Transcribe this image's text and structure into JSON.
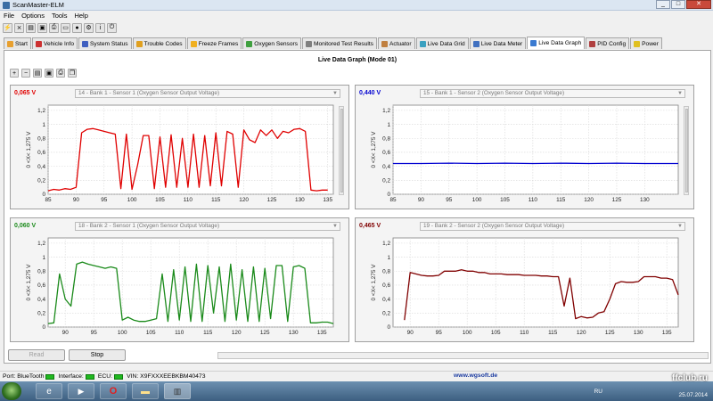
{
  "window": {
    "title": "ScanMaster-ELM",
    "min": "_",
    "max": "□",
    "close": "✕"
  },
  "menu": [
    "File",
    "Options",
    "Tools",
    "Help"
  ],
  "tabs": [
    {
      "label": "Start",
      "color": "#e8a030"
    },
    {
      "label": "Vehicle Info",
      "color": "#cc3030"
    },
    {
      "label": "System Status",
      "color": "#4060c0"
    },
    {
      "label": "Trouble Codes",
      "color": "#e0a020"
    },
    {
      "label": "Freeze Frames",
      "color": "#f0b020"
    },
    {
      "label": "Oxygen Sensors",
      "color": "#40a040"
    },
    {
      "label": "Monitored Test Results",
      "color": "#808080"
    },
    {
      "label": "Actuator",
      "color": "#c08040"
    },
    {
      "label": "Live Data Grid",
      "color": "#3aa0c0"
    },
    {
      "label": "Live Data Meter",
      "color": "#4070c0"
    },
    {
      "label": "Live Data Graph",
      "color": "#3a7ad0",
      "active": true
    },
    {
      "label": "PID Config",
      "color": "#b04040"
    },
    {
      "label": "Power",
      "color": "#e0c020"
    }
  ],
  "page_title": "Live Data Graph (Mode 01)",
  "axis_label": "0 <X< 1,275 V",
  "panels": [
    {
      "value": "0,065 V",
      "pid": "14 - Bank 1 - Sensor 1 (Oxygen Sensor Output Voltage)",
      "color": "#e00000"
    },
    {
      "value": "0,440 V",
      "pid": "15 - Bank 1 - Sensor 2 (Oxygen Sensor Output Voltage)",
      "color": "#0000d0"
    },
    {
      "value": "0,060 V",
      "pid": "18 - Bank 2 - Sensor 1 (Oxygen Sensor Output Voltage)",
      "color": "#1a8a1a"
    },
    {
      "value": "0,465 V",
      "pid": "19 - Bank 2 - Sensor 2 (Oxygen Sensor Output Voltage)",
      "color": "#800000"
    }
  ],
  "buttons": {
    "read": "Read",
    "stop": "Stop"
  },
  "status": {
    "port_label": "Port:",
    "port_value": "BlueTooth",
    "interface_label": "Interface:",
    "ecu_label": "ECU:",
    "vin": "VIN: X9FXXXEEBKBM40473",
    "url": "www.wgsoft.de"
  },
  "tray": {
    "lang": "RU",
    "date": "25.07.2014"
  },
  "watermark": "ffclub.ru",
  "chart_data": [
    {
      "type": "line",
      "title": "14 - Bank 1 - Sensor 1 (Oxygen Sensor Output Voltage)",
      "ylabel": "0 <X< 1,275 V",
      "xlim": [
        85,
        136
      ],
      "ylim": [
        0,
        1.275
      ],
      "xticks": [
        85,
        90,
        95,
        100,
        105,
        110,
        115,
        120,
        125,
        130,
        135
      ],
      "yticks": [
        0,
        0.2,
        0.4,
        0.6,
        0.8,
        1,
        1.2
      ],
      "ytick_labels": [
        "0",
        "0,2",
        "0,4",
        "0,6",
        "0,8",
        "1",
        "1,2"
      ],
      "grid": true,
      "series": [
        {
          "color": "#e00000",
          "points": [
            [
              85,
              0.05
            ],
            [
              86,
              0.07
            ],
            [
              87,
              0.06
            ],
            [
              88,
              0.08
            ],
            [
              89,
              0.07
            ],
            [
              90,
              0.1
            ],
            [
              91,
              0.88
            ],
            [
              92,
              0.93
            ],
            [
              93,
              0.94
            ],
            [
              94,
              0.92
            ],
            [
              95,
              0.9
            ],
            [
              96,
              0.88
            ],
            [
              97,
              0.86
            ],
            [
              98,
              0.08
            ],
            [
              99,
              0.86
            ],
            [
              100,
              0.07
            ],
            [
              101,
              0.42
            ],
            [
              102,
              0.84
            ],
            [
              103,
              0.84
            ],
            [
              104,
              0.08
            ],
            [
              105,
              0.82
            ],
            [
              106,
              0.1
            ],
            [
              107,
              0.85
            ],
            [
              108,
              0.1
            ],
            [
              109,
              0.8
            ],
            [
              110,
              0.1
            ],
            [
              111,
              0.86
            ],
            [
              112,
              0.1
            ],
            [
              113,
              0.84
            ],
            [
              114,
              0.12
            ],
            [
              115,
              0.88
            ],
            [
              116,
              0.12
            ],
            [
              117,
              0.9
            ],
            [
              118,
              0.86
            ],
            [
              119,
              0.1
            ],
            [
              120,
              0.92
            ],
            [
              121,
              0.78
            ],
            [
              122,
              0.74
            ],
            [
              123,
              0.92
            ],
            [
              124,
              0.84
            ],
            [
              125,
              0.92
            ],
            [
              126,
              0.8
            ],
            [
              127,
              0.9
            ],
            [
              128,
              0.88
            ],
            [
              129,
              0.93
            ],
            [
              130,
              0.94
            ],
            [
              131,
              0.9
            ],
            [
              132,
              0.06
            ],
            [
              133,
              0.05
            ],
            [
              134,
              0.06
            ],
            [
              135,
              0.06
            ]
          ]
        }
      ]
    },
    {
      "type": "line",
      "title": "15 - Bank 1 - Sensor 2 (Oxygen Sensor Output Voltage)",
      "ylabel": "0 <X< 1,275 V",
      "xlim": [
        85,
        136
      ],
      "ylim": [
        0,
        1.275
      ],
      "xticks": [
        85,
        90,
        95,
        100,
        105,
        110,
        115,
        120,
        125,
        130
      ],
      "yticks": [
        0,
        0.2,
        0.4,
        0.6,
        0.8,
        1,
        1.2
      ],
      "ytick_labels": [
        "0",
        "0,2",
        "0,4",
        "0,6",
        "0,8",
        "1",
        "1,2"
      ],
      "grid": true,
      "series": [
        {
          "color": "#0000d0",
          "points": [
            [
              85,
              0.44
            ],
            [
              90,
              0.44
            ],
            [
              95,
              0.445
            ],
            [
              100,
              0.44
            ],
            [
              105,
              0.445
            ],
            [
              110,
              0.44
            ],
            [
              115,
              0.445
            ],
            [
              120,
              0.44
            ],
            [
              125,
              0.445
            ],
            [
              130,
              0.44
            ],
            [
              135,
              0.44
            ],
            [
              136,
              0.44
            ]
          ]
        }
      ]
    },
    {
      "type": "line",
      "title": "18 - Bank 2 - Sensor 1 (Oxygen Sensor Output Voltage)",
      "ylabel": "0 <X< 1,275 V",
      "xlim": [
        87,
        137
      ],
      "ylim": [
        0,
        1.275
      ],
      "xticks": [
        90,
        95,
        100,
        105,
        110,
        115,
        120,
        125,
        130,
        135
      ],
      "yticks": [
        0,
        0.2,
        0.4,
        0.6,
        0.8,
        1,
        1.2
      ],
      "ytick_labels": [
        "0",
        "0,2",
        "0,4",
        "0,6",
        "0,8",
        "1",
        "1,2"
      ],
      "grid": true,
      "series": [
        {
          "color": "#1a8a1a",
          "points": [
            [
              87,
              0.05
            ],
            [
              88,
              0.06
            ],
            [
              89,
              0.76
            ],
            [
              90,
              0.4
            ],
            [
              91,
              0.3
            ],
            [
              92,
              0.9
            ],
            [
              93,
              0.93
            ],
            [
              94,
              0.9
            ],
            [
              95,
              0.88
            ],
            [
              96,
              0.86
            ],
            [
              97,
              0.84
            ],
            [
              98,
              0.86
            ],
            [
              99,
              0.84
            ],
            [
              100,
              0.1
            ],
            [
              101,
              0.14
            ],
            [
              102,
              0.1
            ],
            [
              103,
              0.08
            ],
            [
              104,
              0.08
            ],
            [
              105,
              0.1
            ],
            [
              106,
              0.12
            ],
            [
              107,
              0.76
            ],
            [
              108,
              0.08
            ],
            [
              109,
              0.82
            ],
            [
              110,
              0.1
            ],
            [
              111,
              0.86
            ],
            [
              112,
              0.08
            ],
            [
              113,
              0.9
            ],
            [
              114,
              0.08
            ],
            [
              115,
              0.88
            ],
            [
              116,
              0.2
            ],
            [
              117,
              0.86
            ],
            [
              118,
              0.08
            ],
            [
              119,
              0.9
            ],
            [
              120,
              0.1
            ],
            [
              121,
              0.82
            ],
            [
              122,
              0.08
            ],
            [
              123,
              0.86
            ],
            [
              124,
              0.08
            ],
            [
              125,
              0.84
            ],
            [
              126,
              0.12
            ],
            [
              127,
              0.88
            ],
            [
              128,
              0.88
            ],
            [
              129,
              0.08
            ],
            [
              130,
              0.86
            ],
            [
              131,
              0.88
            ],
            [
              132,
              0.84
            ],
            [
              133,
              0.06
            ],
            [
              134,
              0.06
            ],
            [
              135,
              0.07
            ],
            [
              136,
              0.07
            ],
            [
              137,
              0.05
            ]
          ]
        }
      ]
    },
    {
      "type": "line",
      "title": "19 - Bank 2 - Sensor 2 (Oxygen Sensor Output Voltage)",
      "ylabel": "0 <X< 1,275 V",
      "xlim": [
        87,
        137
      ],
      "ylim": [
        0,
        1.275
      ],
      "xticks": [
        90,
        95,
        100,
        105,
        110,
        115,
        120,
        125,
        130,
        135
      ],
      "yticks": [
        0,
        0.2,
        0.4,
        0.6,
        0.8,
        1,
        1.2
      ],
      "ytick_labels": [
        "0",
        "0,2",
        "0,4",
        "0,6",
        "0,8",
        "1",
        "1,2"
      ],
      "grid": true,
      "series": [
        {
          "color": "#800000",
          "points": [
            [
              89,
              0.1
            ],
            [
              90,
              0.78
            ],
            [
              91,
              0.76
            ],
            [
              92,
              0.74
            ],
            [
              93,
              0.73
            ],
            [
              94,
              0.73
            ],
            [
              95,
              0.74
            ],
            [
              96,
              0.8
            ],
            [
              97,
              0.8
            ],
            [
              98,
              0.8
            ],
            [
              99,
              0.82
            ],
            [
              100,
              0.8
            ],
            [
              101,
              0.8
            ],
            [
              102,
              0.78
            ],
            [
              103,
              0.78
            ],
            [
              104,
              0.76
            ],
            [
              105,
              0.76
            ],
            [
              106,
              0.76
            ],
            [
              107,
              0.75
            ],
            [
              108,
              0.75
            ],
            [
              109,
              0.75
            ],
            [
              110,
              0.74
            ],
            [
              111,
              0.74
            ],
            [
              112,
              0.74
            ],
            [
              113,
              0.73
            ],
            [
              114,
              0.73
            ],
            [
              115,
              0.72
            ],
            [
              116,
              0.72
            ],
            [
              117,
              0.3
            ],
            [
              118,
              0.7
            ],
            [
              119,
              0.12
            ],
            [
              120,
              0.15
            ],
            [
              121,
              0.13
            ],
            [
              122,
              0.14
            ],
            [
              123,
              0.2
            ],
            [
              124,
              0.22
            ],
            [
              125,
              0.4
            ],
            [
              126,
              0.62
            ],
            [
              127,
              0.65
            ],
            [
              128,
              0.64
            ],
            [
              129,
              0.64
            ],
            [
              130,
              0.65
            ],
            [
              131,
              0.72
            ],
            [
              132,
              0.72
            ],
            [
              133,
              0.72
            ],
            [
              134,
              0.7
            ],
            [
              135,
              0.7
            ],
            [
              136,
              0.68
            ],
            [
              137,
              0.46
            ]
          ]
        }
      ]
    }
  ]
}
